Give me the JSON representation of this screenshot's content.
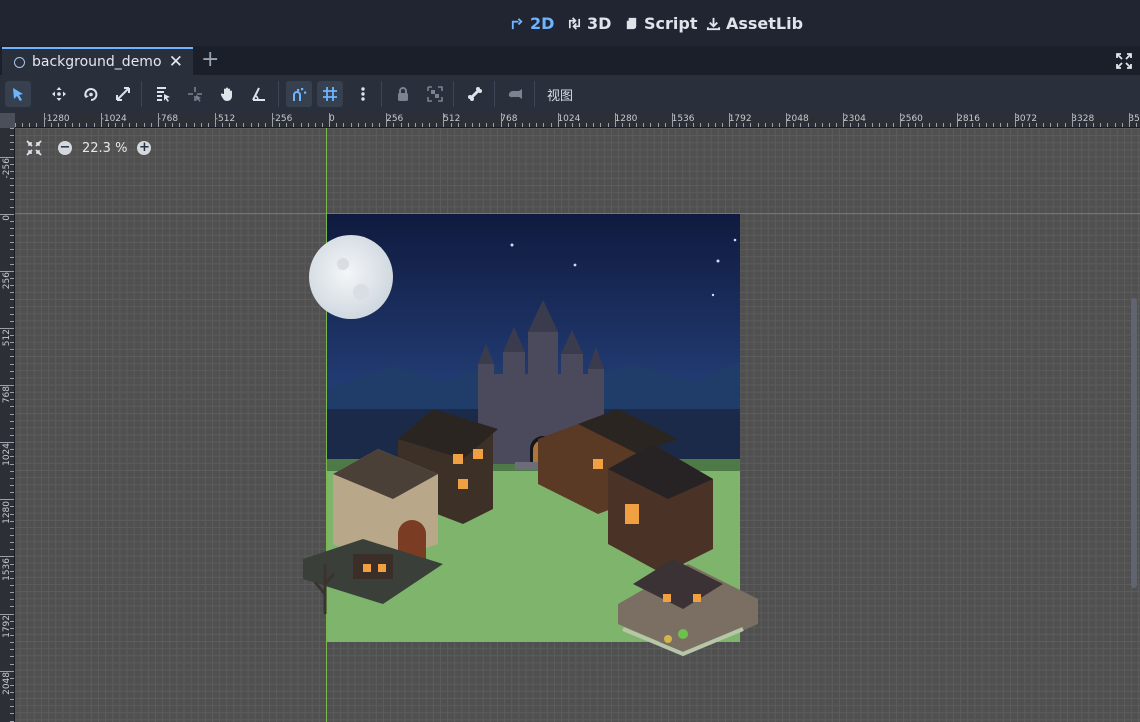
{
  "workspaces": [
    {
      "label": "2D",
      "icon": "2d-icon",
      "active": true
    },
    {
      "label": "3D",
      "icon": "3d-icon",
      "active": false
    },
    {
      "label": "Script",
      "icon": "script-icon",
      "active": false
    },
    {
      "label": "AssetLib",
      "icon": "assetlib-icon",
      "active": false
    }
  ],
  "tabs": {
    "scene_tab_label": "background_demo",
    "close_glyph": "✕",
    "add_glyph": "+"
  },
  "toolbar": {
    "view_menu_label": "视图"
  },
  "viewport": {
    "zoom_label": "22.3 %",
    "zoom_out_glyph": "−",
    "zoom_in_glyph": "+",
    "ruler_top_labels": [
      "-1280",
      "-1024",
      "-768",
      "-512",
      "-256",
      "0",
      "256",
      "512",
      "768",
      "1024",
      "1280",
      "1536",
      "1792",
      "2048",
      "2304",
      "2560",
      "2816",
      "3072",
      "3328",
      "35"
    ],
    "ruler_left_labels": [
      "-256",
      "0",
      "256",
      "512",
      "768",
      "1024",
      "1280",
      "1536",
      "1792",
      "2048"
    ]
  },
  "colors": {
    "accent": "#6eb4ff",
    "x_axis": "#d8525d",
    "y_axis": "#7fc14d"
  }
}
